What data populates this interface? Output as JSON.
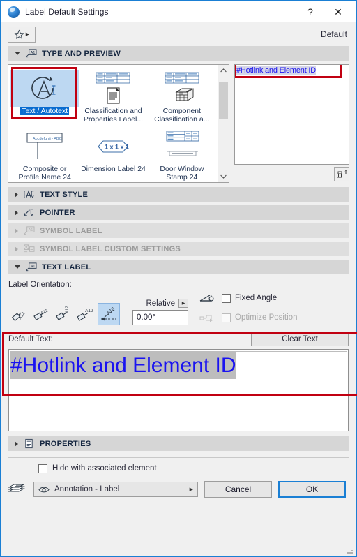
{
  "window": {
    "title": "Label Default Settings",
    "app_icon": "archicad-ball-icon",
    "help_label": "?",
    "close_label": "✕",
    "accent_color": "#1a7fd4",
    "annotation_color": "#c10011"
  },
  "toolbar": {
    "favorites_icon": "star-icon",
    "favorites_arrow": "▶",
    "default_label": "Default"
  },
  "sections": {
    "type_and_preview": {
      "title": "TYPE AND PREVIEW",
      "icon": "label-a1-icon",
      "expanded": true,
      "enabled": true
    },
    "text_style": {
      "title": "TEXT STYLE",
      "icon": "text-style-icon",
      "expanded": false,
      "enabled": true
    },
    "pointer": {
      "title": "POINTER",
      "icon": "pointer-icon",
      "expanded": false,
      "enabled": true
    },
    "symbol_label": {
      "title": "SYMBOL LABEL",
      "icon": "symbol-label-icon",
      "expanded": false,
      "enabled": false
    },
    "symbol_label_custom": {
      "title": "SYMBOL LABEL CUSTOM SETTINGS",
      "icon": "symbol-custom-icon",
      "expanded": false,
      "enabled": false
    },
    "text_label": {
      "title": "TEXT LABEL",
      "icon": "text-label-icon",
      "expanded": true,
      "enabled": true
    },
    "properties": {
      "title": "PROPERTIES",
      "icon": "properties-icon",
      "expanded": false,
      "enabled": true
    }
  },
  "type_grid": {
    "items": [
      {
        "label": "Text / Autotext",
        "icon": "autotext-a-icon",
        "selected": true
      },
      {
        "label": "Classification and Properties Label...",
        "icon": "classification-table-icon",
        "selected": false
      },
      {
        "label": "Component Classification a...",
        "icon": "component-classification-icon",
        "selected": false
      },
      {
        "label": "Composite or Profile Name 24",
        "icon": "composite-profile-icon",
        "selected": false
      },
      {
        "label": "Dimension Label 24",
        "icon": "dimension-label-icon",
        "selected": false
      },
      {
        "label": "Door Window Stamp 24",
        "icon": "door-window-stamp-icon",
        "selected": false
      }
    ],
    "scroll_up_icon": "chevron-up-icon",
    "scroll_down_icon": "chevron-down-icon"
  },
  "preview": {
    "text": "#Hotlink and Element ID",
    "perspective_button_icon": "perspective-view-icon"
  },
  "text_label": {
    "orientation_label": "Label Orientation:",
    "orientation_buttons": [
      {
        "name": "orientation-horizontal",
        "label": "A12",
        "selected": false
      },
      {
        "name": "orientation-aligned",
        "label": "A12",
        "selected": false
      },
      {
        "name": "orientation-vertical",
        "label": "A12",
        "selected": false
      },
      {
        "name": "orientation-flat",
        "label": "A12",
        "selected": false
      },
      {
        "name": "orientation-custom-angle",
        "label": "A12",
        "selected": true
      }
    ],
    "relative_label": "Relative",
    "relative_arrow": "▶",
    "angle_value": "0.00°",
    "fixed_angle": {
      "label": "Fixed Angle",
      "checked": false,
      "enabled": true,
      "icon": "angle-lock-icon"
    },
    "optimize_position": {
      "label": "Optimize Position",
      "checked": false,
      "enabled": false,
      "icon": "optimize-position-icon"
    }
  },
  "default_text": {
    "label": "Default Text:",
    "clear_button": "Clear Text",
    "value": "#Hotlink and Element ID"
  },
  "footer": {
    "hide_with_element": {
      "label": "Hide with associated element",
      "checked": false
    },
    "layer_icon": "layers-icon",
    "layer_eye_icon": "eye-icon",
    "layer_value": "Annotation - Label",
    "layer_arrow": "▶",
    "cancel_label": "Cancel",
    "ok_label": "OK"
  }
}
